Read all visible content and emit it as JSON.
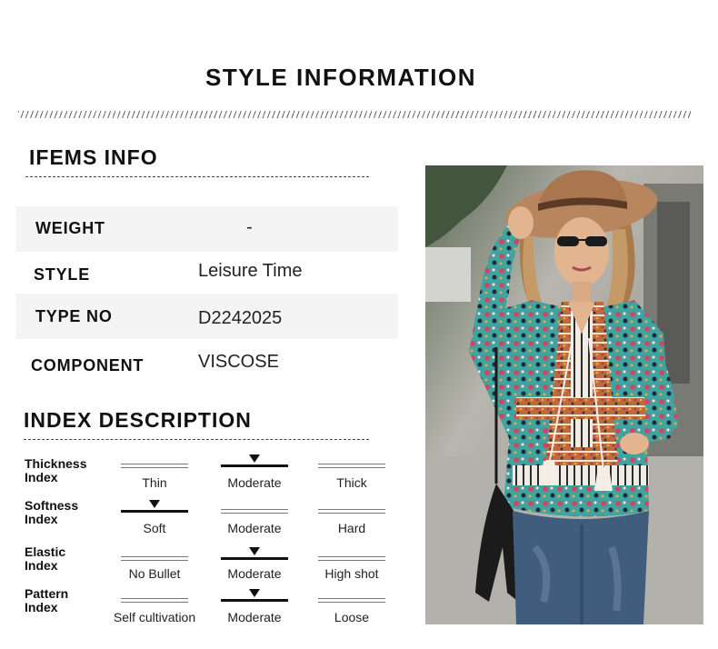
{
  "header": {
    "title": "STYLE INFORMATION"
  },
  "items_info": {
    "heading": "IFEMS INFO",
    "rows": [
      {
        "label": "WEIGHT",
        "value": "-"
      },
      {
        "label": "STYLE",
        "value": "Leisure Time"
      },
      {
        "label": "TYPE NO",
        "value": "D2242025"
      },
      {
        "label": "COMPONENT",
        "value": "VISCOSE"
      }
    ]
  },
  "index": {
    "heading": "INDEX DESCRIPTION",
    "rows": [
      {
        "label_1": "Thickness",
        "label_2": "Index",
        "options": [
          "Thin",
          "Moderate",
          "Thick"
        ],
        "selected": "Moderate"
      },
      {
        "label_1": "Softness",
        "label_2": "Index",
        "options": [
          "Soft",
          "Moderate",
          "Hard"
        ],
        "selected": "Soft"
      },
      {
        "label_1": "Elastic",
        "label_2": "Index",
        "options": [
          "No Bullet",
          "Moderate",
          "High shot"
        ],
        "selected": "Moderate"
      },
      {
        "label_1": "Pattern",
        "label_2": "Index",
        "options": [
          "Self cultivation",
          "Moderate",
          "Loose"
        ],
        "selected": "Moderate"
      }
    ]
  },
  "colors": {
    "text": "#111111",
    "row_shade": "#f4f4f4"
  },
  "photo": {
    "icon": "model-photo"
  }
}
